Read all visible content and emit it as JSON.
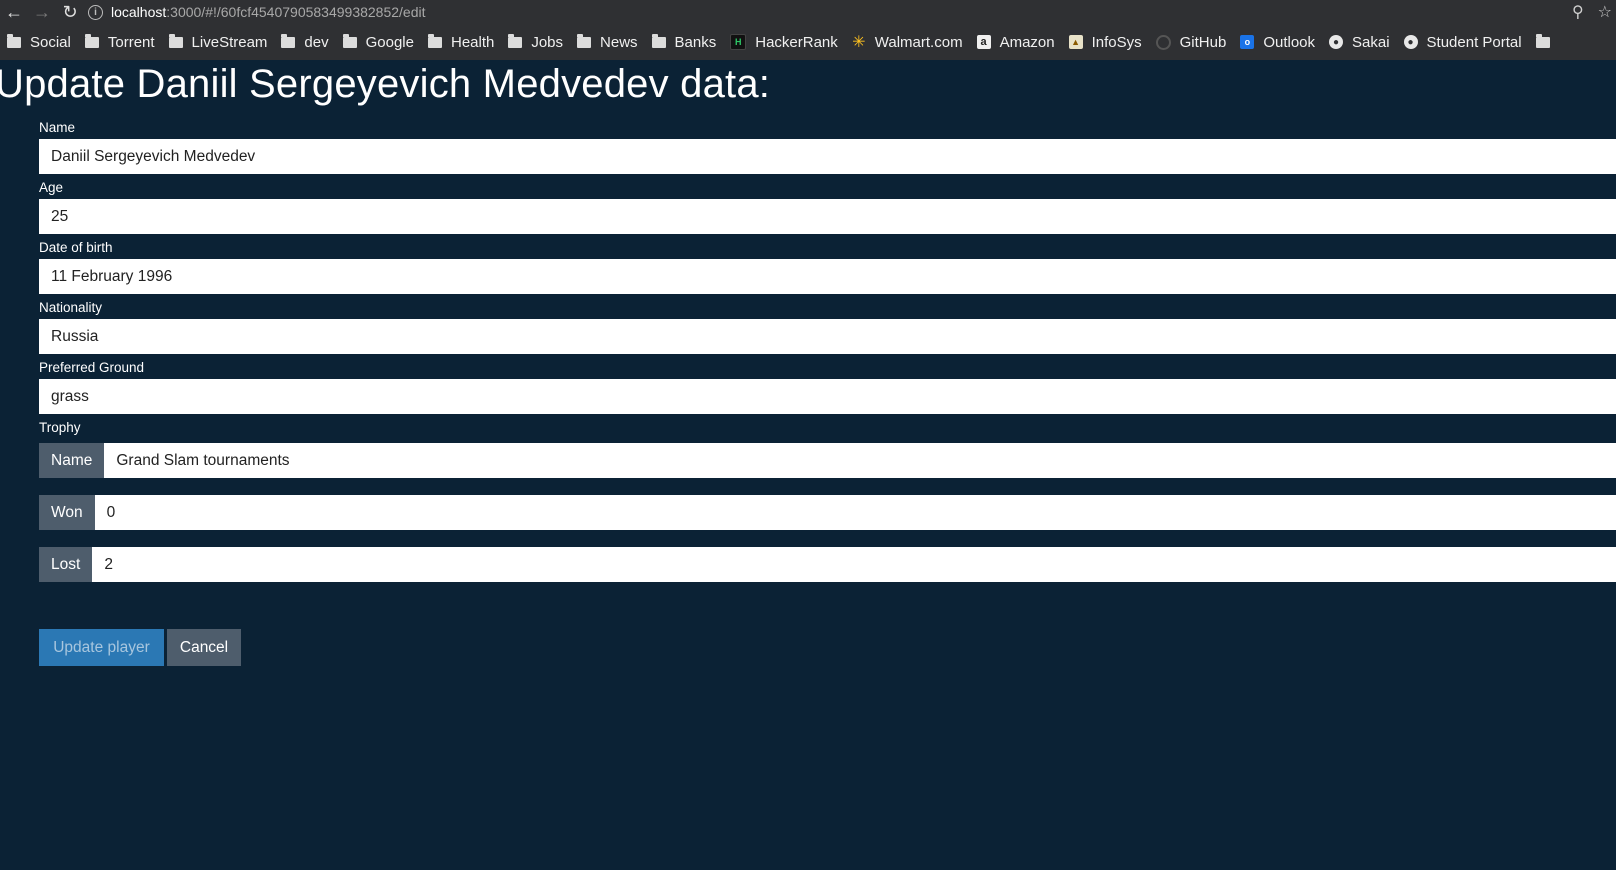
{
  "browser": {
    "url_host": "localhost",
    "url_rest": ":3000/#!/60fcf4540790583499382852/edit"
  },
  "bookmarks": [
    {
      "label": "Social",
      "icon": "folder-icon"
    },
    {
      "label": "Torrent",
      "icon": "folder-icon"
    },
    {
      "label": "LiveStream",
      "icon": "folder-icon"
    },
    {
      "label": "dev",
      "icon": "folder-icon"
    },
    {
      "label": "Google",
      "icon": "folder-icon"
    },
    {
      "label": "Health",
      "icon": "folder-icon"
    },
    {
      "label": "Jobs",
      "icon": "folder-icon"
    },
    {
      "label": "News",
      "icon": "folder-icon"
    },
    {
      "label": "Banks",
      "icon": "folder-icon"
    },
    {
      "label": "HackerRank",
      "icon": "hackerrank-icon"
    },
    {
      "label": "Walmart.com",
      "icon": "walmart-icon"
    },
    {
      "label": "Amazon",
      "icon": "amazon-icon"
    },
    {
      "label": "InfoSys",
      "icon": "infosys-icon"
    },
    {
      "label": "GitHub",
      "icon": "github-icon"
    },
    {
      "label": "Outlook",
      "icon": "outlook-icon"
    },
    {
      "label": "Sakai",
      "icon": "globe-icon"
    },
    {
      "label": "Student Portal",
      "icon": "globe-icon"
    }
  ],
  "page": {
    "title": "Update Daniil Sergeyevich Medvedev data:"
  },
  "form": {
    "name_label": "Name",
    "name_value": "Daniil Sergeyevich Medvedev",
    "age_label": "Age",
    "age_value": "25",
    "dob_label": "Date of birth",
    "dob_value": "11 February 1996",
    "nationality_label": "Nationality",
    "nationality_value": "Russia",
    "ground_label": "Preferred Ground",
    "ground_value": "grass",
    "trophy_label": "Trophy",
    "trophy_name_addon": "Name",
    "trophy_name_value": "Grand Slam tournaments",
    "won_addon": "Won",
    "won_value": "0",
    "lost_addon": "Lost",
    "lost_value": "2"
  },
  "buttons": {
    "update": "Update player",
    "cancel": "Cancel"
  },
  "colors": {
    "background": "#0b2235",
    "primary": "#2b78b4",
    "addon": "#4e5d6c"
  }
}
